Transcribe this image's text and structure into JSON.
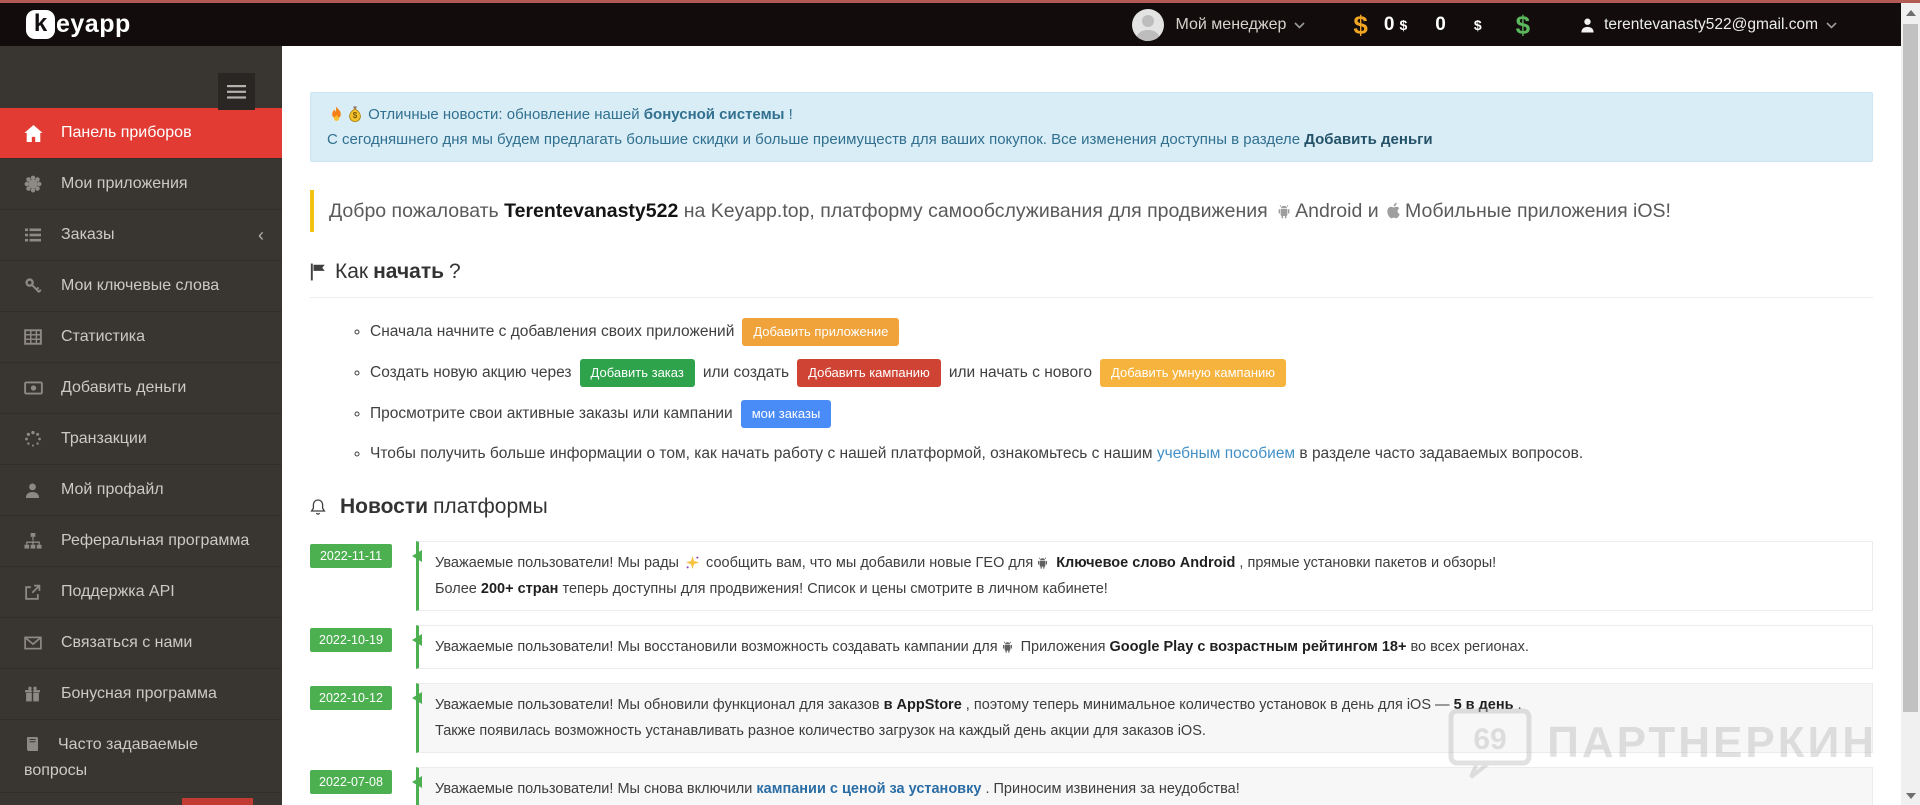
{
  "topbar": {
    "logo_k": "k",
    "logo_rest": "eyapp",
    "manager_label": "Мой менеджер",
    "balances": {
      "icon_dollar": "$",
      "amount1": "0",
      "cur1": "$",
      "amount2": "0",
      "cur2": "$"
    },
    "email": "terentevanasty522@gmail.com"
  },
  "sidebar": {
    "items": [
      {
        "label": "Панель приборов"
      },
      {
        "label": "Мои приложения"
      },
      {
        "label": "Заказы",
        "chevron": "‹"
      },
      {
        "label": "Мои ключевые слова"
      },
      {
        "label": "Статистика"
      },
      {
        "label": "Добавить деньги"
      },
      {
        "label": "Транзакции"
      },
      {
        "label": "Мой профайл"
      },
      {
        "label": "Реферальная программа"
      },
      {
        "label": "Поддержка API"
      },
      {
        "label": "Связаться с нами"
      },
      {
        "label": "Бонусная программа"
      },
      {
        "label": "Часто задаваемые вопросы"
      }
    ]
  },
  "alert": {
    "line1_pre": "Отличные новости: обновление нашей ",
    "line1_bold": "бонусной системы",
    "line1_post": " !",
    "line2_pre": "С сегодняшнего дня мы будем предлагать большие скидки и больше преимуществ для ваших покупок. Все изменения доступны в разделе ",
    "line2_link": "Добавить деньги"
  },
  "welcome": {
    "pre": "Добро пожаловать ",
    "name": "Terentevanasty522",
    "mid": " на Keyapp.top, платформу самообслуживания для продвижения ",
    "android": "Android",
    "conj": " и ",
    "ios": "Мобильные приложения iOS!"
  },
  "how_to": {
    "title": {
      "pre": "Как",
      "bold": "начать",
      "post": "?"
    },
    "bullets": {
      "b1": {
        "text": "Сначала начните с добавления своих приложений",
        "button": "Добавить приложение"
      },
      "b2": {
        "t1": "Создать новую акцию через",
        "btn_green": "Добавить заказ",
        "t2": "или создать",
        "btn_red": "Добавить кампанию",
        "t3": "или начать с нового",
        "btn_amber": "Добавить умную кампанию"
      },
      "b3": {
        "text": "Просмотрите свои активные заказы или кампании",
        "button": "мои заказы"
      },
      "b4": {
        "t1": "Чтобы получить больше информации о том, как начать работу с нашей платформой, ознакомьтесь с нашим ",
        "link": "учебным пособием",
        "t2": " в разделе часто задаваемых вопросов."
      }
    }
  },
  "news": {
    "title": {
      "bold": "Новости",
      "rest": " платформы"
    },
    "items": [
      {
        "date": "2022-11-11",
        "t1": "Уважаемые пользователи! Мы рады ",
        "t2": " сообщить вам, что мы добавили новые ГЕО для",
        "b1": "Ключевое слово Android",
        "t3": " , прямые установки пакетов и обзоры!",
        "t4": "Более ",
        "b2": "200+ стран",
        "t5": " теперь доступны для продвижения! Список и цены смотрите в личном кабинете!"
      },
      {
        "date": "2022-10-19",
        "t1": "Уважаемые пользователи! Мы восстановили возможность создавать кампании для",
        "t2": " Приложения ",
        "b1": "Google Play с возрастным рейтингом 18+",
        "t3": " во всех регионах."
      },
      {
        "date": "2022-10-12",
        "t1": "Уважаемые пользователи! Мы обновили функционал для заказов ",
        "b1": "в AppStore",
        "t2": " , поэтому теперь минимальное количество установок в день для iOS — ",
        "b2": "5 в день",
        "t3": " .",
        "t4": "Также появилась возможность устанавливать разное количество загрузок на каждый день акции для заказов iOS."
      },
      {
        "date": "2022-07-08",
        "t1": "Уважаемые пользователи! Мы снова включили ",
        "link": "кампании с ценой за установку",
        "t2": " . Приносим извинения за неудобства!"
      }
    ]
  },
  "watermark": {
    "text": "ПАРТНЕРКИН",
    "bubble_text": "69"
  },
  "colors": {
    "accent_red": "#e23b33",
    "badge_green": "#4caf50",
    "alert_bg": "#d9edf7",
    "alert_text": "#31708f",
    "welcome_border": "#f1c40f",
    "btn_orange": "#f0a23b",
    "btn_green": "#2fa24c",
    "btn_red": "#ce4334",
    "btn_amber": "#f6b33d",
    "btn_blue": "#4a8cf7",
    "dollar_orange": "#f0a622",
    "dollar_green": "#5cb85c"
  }
}
